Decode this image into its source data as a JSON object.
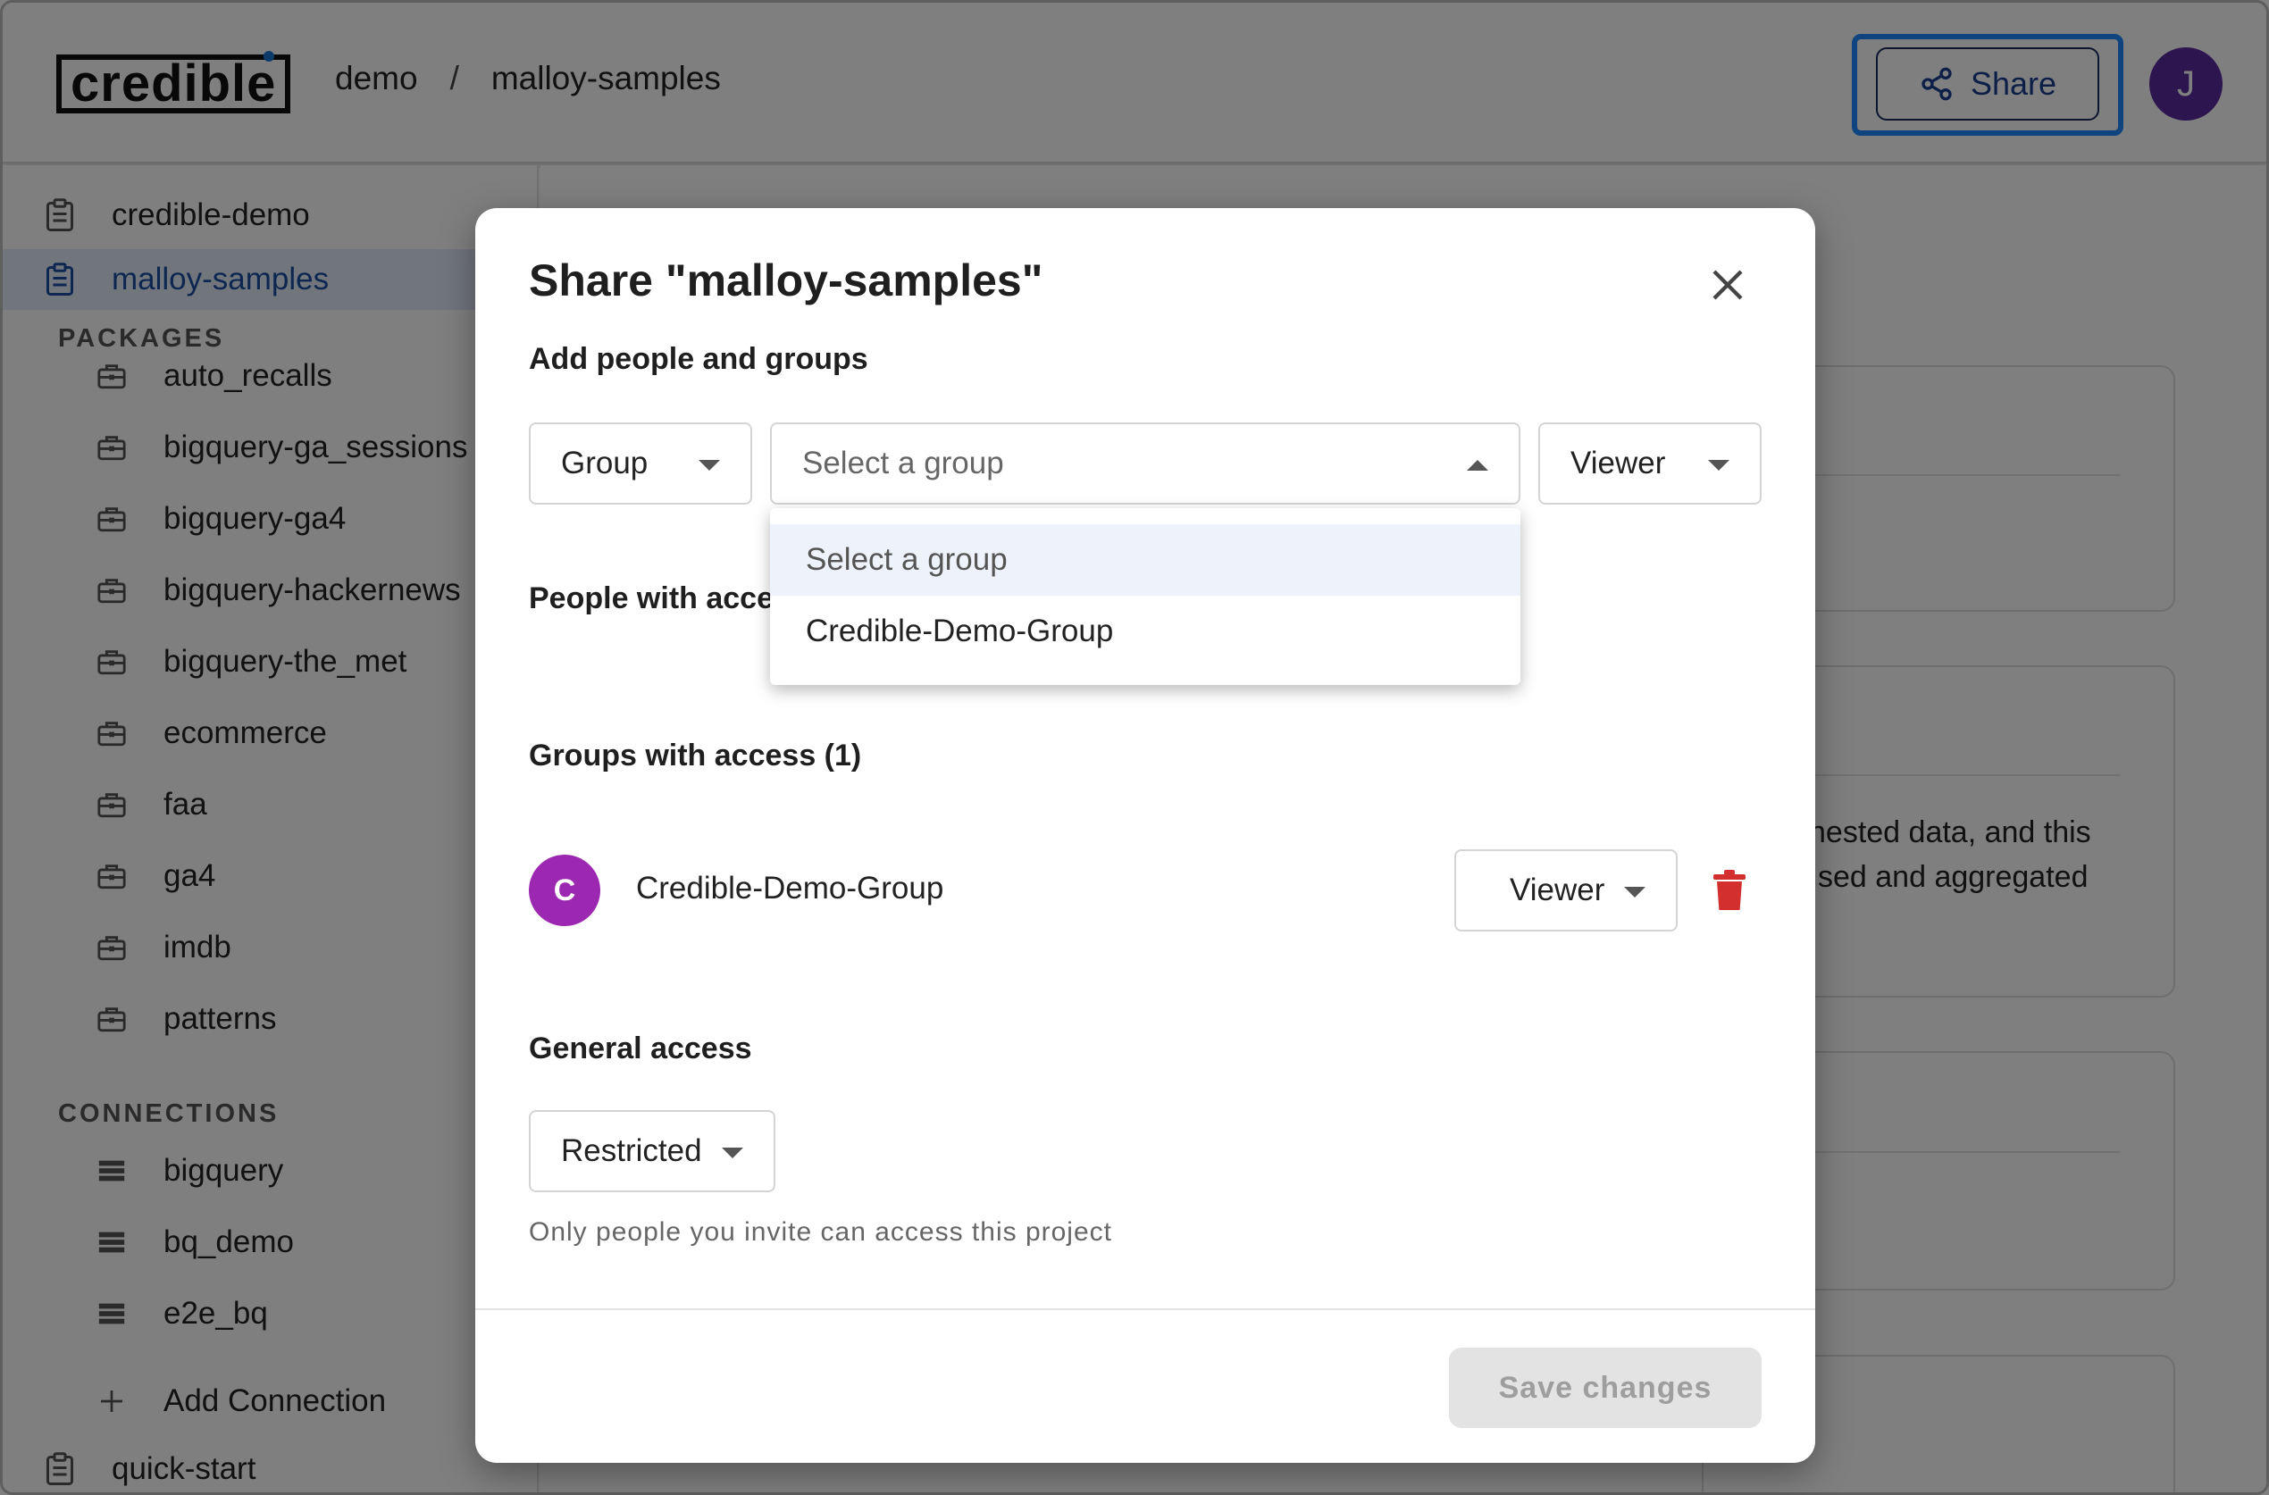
{
  "header": {
    "logo_text": "credible",
    "breadcrumb": [
      "demo",
      "malloy-samples"
    ],
    "breadcrumb_sep": "/",
    "share_label": "Share",
    "avatar_initial": "J",
    "colors": {
      "focus_ring": "#1e88ff",
      "avatar": "#5b2a9e"
    }
  },
  "sidebar": {
    "projects_top": [
      {
        "label": "credible-demo",
        "icon": "clipboard-icon"
      },
      {
        "label": "malloy-samples",
        "icon": "clipboard-icon",
        "active": true
      }
    ],
    "packages_heading": "PACKAGES",
    "packages": [
      "auto_recalls",
      "bigquery-ga_sessions",
      "bigquery-ga4",
      "bigquery-hackernews",
      "bigquery-the_met",
      "ecommerce",
      "faa",
      "ga4",
      "imdb",
      "patterns"
    ],
    "connections_heading": "CONNECTIONS",
    "connections": [
      "bigquery",
      "bq_demo",
      "e2e_bq"
    ],
    "add_connection": "Add Connection",
    "project_bottom": "quick-start"
  },
  "background": {
    "text_lines": [
      "nested data, and this",
      "sed and aggregated"
    ]
  },
  "modal": {
    "title": "Share \"malloy-samples\"",
    "add_heading": "Add people and groups",
    "type_select": "Group",
    "group_select_placeholder": "Select a group",
    "role_select": "Viewer",
    "dropdown_options": [
      "Select a group",
      "Credible-Demo-Group"
    ],
    "people_heading": "People with acce",
    "groups_heading": "Groups with access (1)",
    "groups": [
      {
        "initial": "C",
        "name": "Credible-Demo-Group",
        "role": "Viewer",
        "avatar_color": "#9c27b0"
      }
    ],
    "general_heading": "General access",
    "general_select": "Restricted",
    "general_help": "Only people you invite can access this project",
    "save_label": "Save changes"
  }
}
